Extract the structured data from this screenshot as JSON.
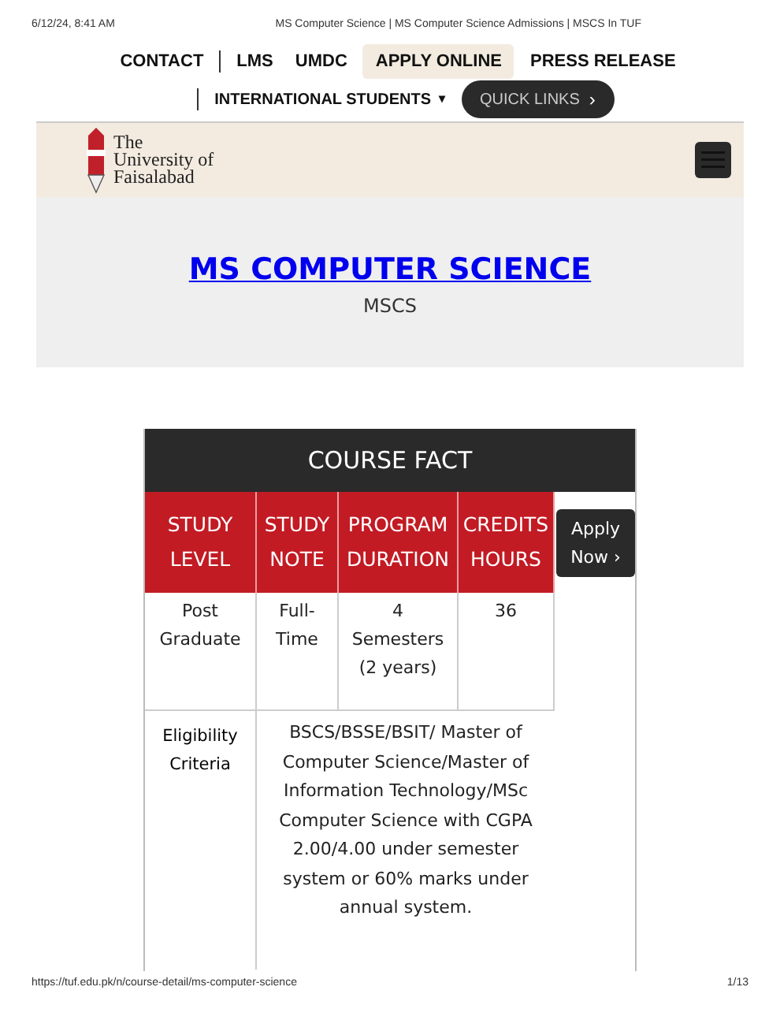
{
  "print_header": {
    "date": "6/12/24, 8:41 AM",
    "title": "MS Computer Science | MS Computer Science Admissions | MSCS In TUF"
  },
  "nav": {
    "items": [
      {
        "label": "CONTACT",
        "selected": false,
        "separator": true
      },
      {
        "label": "LMS",
        "selected": false,
        "separator": false
      },
      {
        "label": "UMDC",
        "selected": false,
        "separator": false
      },
      {
        "label": "APPLY ONLINE",
        "selected": true,
        "separator": false
      },
      {
        "label": "PRESS RELEASE",
        "selected": false,
        "separator": false
      }
    ],
    "dropdown": {
      "label": "INTERNATIONAL STUDENTS",
      "caret": "▾"
    },
    "quick_links": {
      "label": "QUICK LINKS",
      "arrow": "›"
    }
  },
  "logo": {
    "text": "The\nUniversity of\nFaisalabad"
  },
  "hero": {
    "title": "MS COMPUTER SCIENCE",
    "subtitle": "MSCS"
  },
  "course_fact": {
    "title": "COURSE FACT",
    "columns": [
      "STUDY LEVEL",
      "STUDY NOTE",
      "PROGRAM DURATION",
      "CREDITS HOURS"
    ],
    "row": [
      "Post Graduate",
      "Full-Time",
      "4 Semesters (2 years)",
      "36"
    ],
    "apply_button": {
      "label": "Apply Now",
      "arrow": "›"
    },
    "eligibility": {
      "label": "Eligibility Criteria",
      "text": "BSCS/BSSE/BSIT/ Master of Computer Science/Master of Information Technology/MSc Computer Science with CGPA 2.00/4.00 under semester system or 60% marks under annual system."
    }
  },
  "print_footer": {
    "url": "https://tuf.edu.pk/n/course-detail/ms-computer-science",
    "page": "1/13"
  }
}
